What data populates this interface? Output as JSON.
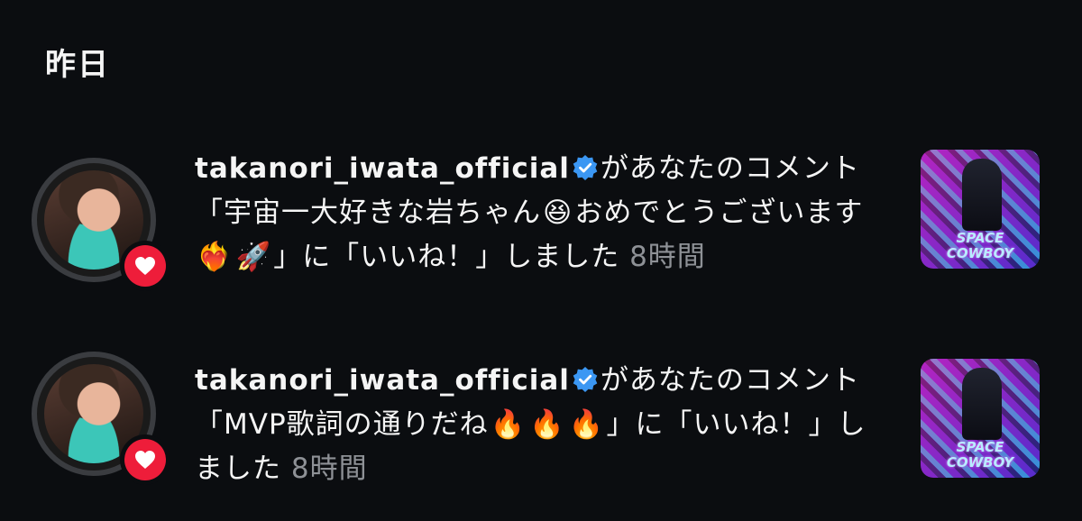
{
  "section": {
    "title": "昨日"
  },
  "notifications": [
    {
      "username": "takanori_iwata_official",
      "action_prefix": "があなたのコメント「",
      "comment_parts": [
        "宇宙一大好きな岩ちゃん",
        "😆",
        "おめでとうございます",
        "❤️‍🔥",
        "🚀"
      ],
      "action_suffix": "」に「いいね！」しました",
      "time": "8時間",
      "thumbnail_text": "SPACE\nCOWBOY"
    },
    {
      "username": "takanori_iwata_official",
      "action_prefix": "があなたのコメント「",
      "comment_parts": [
        "MVP歌詞の通りだね",
        "🔥",
        "🔥",
        "🔥"
      ],
      "action_suffix": "」に「いいね！」しました",
      "time": "8時間",
      "thumbnail_text": "SPACE\nCOWBOY"
    }
  ],
  "colors": {
    "like_badge": "#ee1d3a",
    "verified": "#3b97f3",
    "background": "#0b0d10"
  }
}
